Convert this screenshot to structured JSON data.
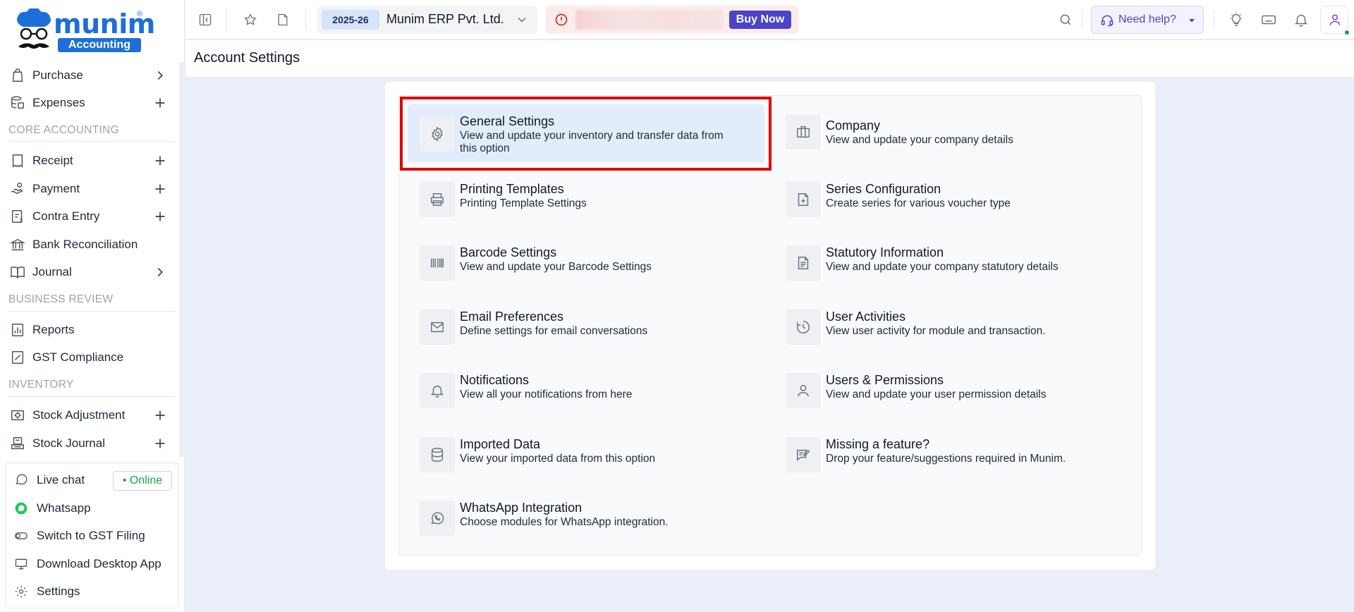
{
  "brand": {
    "name": "munim",
    "sub": "Accounting",
    "reg": "®"
  },
  "sidebar": {
    "items": [
      {
        "label": "Purchase",
        "icon": "bag-icon",
        "action": "chevron-right-icon"
      },
      {
        "label": "Expenses",
        "icon": "database-icon",
        "action": "plus-icon"
      }
    ],
    "core_section": "CORE ACCOUNTING",
    "core_items": [
      {
        "label": "Receipt",
        "icon": "receipt-icon",
        "action": "plus-icon"
      },
      {
        "label": "Payment",
        "icon": "payment-icon",
        "action": "plus-icon"
      },
      {
        "label": "Contra Entry",
        "icon": "contra-icon",
        "action": "plus-icon"
      },
      {
        "label": "Bank Reconciliation",
        "icon": "bank-icon",
        "action": ""
      },
      {
        "label": "Journal",
        "icon": "book-icon",
        "action": "chevron-right-icon"
      }
    ],
    "review_section": "BUSINESS REVIEW",
    "review_items": [
      {
        "label": "Reports",
        "icon": "report-icon",
        "action": ""
      },
      {
        "label": "GST Compliance",
        "icon": "gst-icon",
        "action": ""
      }
    ],
    "inventory_section": "INVENTORY",
    "inventory_items": [
      {
        "label": "Stock Adjustment",
        "icon": "stock-adjustment-icon",
        "action": "plus-icon"
      },
      {
        "label": "Stock Journal",
        "icon": "stock-journal-icon",
        "action": "plus-icon"
      }
    ],
    "help": {
      "live_chat": "Live chat",
      "online": "• Online",
      "whatsapp": "Whatsapp",
      "switch_gst": "Switch to GST Filing",
      "download": "Download Desktop App",
      "settings": "Settings"
    }
  },
  "topbar": {
    "year": "2025-26",
    "company": "Munim ERP Pvt. Ltd.",
    "buy_now": "Buy Now",
    "need_help": "Need help?"
  },
  "page": {
    "title": "Account Settings"
  },
  "settings": [
    {
      "title": "General Settings",
      "desc1": "View and update your inventory and transfer data from",
      "desc2": "this option",
      "icon": "gear-icon"
    },
    {
      "title": "Company",
      "desc1": "View and update your company details",
      "desc2": "",
      "icon": "briefcase-icon"
    },
    {
      "title": "Printing Templates",
      "desc1": "Printing Template Settings",
      "desc2": "",
      "icon": "printer-icon"
    },
    {
      "title": "Series Configuration",
      "desc1": "Create series for various voucher type",
      "desc2": "",
      "icon": "file-plus-icon"
    },
    {
      "title": "Barcode Settings",
      "desc1": "View and update your Barcode Settings",
      "desc2": "",
      "icon": "barcode-icon"
    },
    {
      "title": "Statutory Information",
      "desc1": "View and update your company statutory details",
      "desc2": "",
      "icon": "document-icon"
    },
    {
      "title": "Email Preferences",
      "desc1": "Define settings for email conversations",
      "desc2": "",
      "icon": "mail-icon"
    },
    {
      "title": "User Activities",
      "desc1": "View user activity for module and transaction.",
      "desc2": "",
      "icon": "history-icon"
    },
    {
      "title": "Notifications",
      "desc1": "View all your notifications from here",
      "desc2": "",
      "icon": "bell-icon"
    },
    {
      "title": "Users & Permissions",
      "desc1": "View and update your user permission details",
      "desc2": "",
      "icon": "user-icon"
    },
    {
      "title": "Imported Data",
      "desc1": "View your imported data from this option",
      "desc2": "",
      "icon": "database-icon"
    },
    {
      "title": "Missing a feature?",
      "desc1": "Drop your feature/suggestions required in Munim.",
      "desc2": "",
      "icon": "feedback-icon"
    },
    {
      "title": "WhatsApp Integration",
      "desc1": "Choose modules for WhatsApp integration.",
      "desc2": "",
      "icon": "whatsapp-icon"
    }
  ],
  "colors": {
    "accent": "#1d6fd8",
    "buy": "#4c44c7",
    "highlight": "#e00000",
    "online": "#16a34a"
  }
}
